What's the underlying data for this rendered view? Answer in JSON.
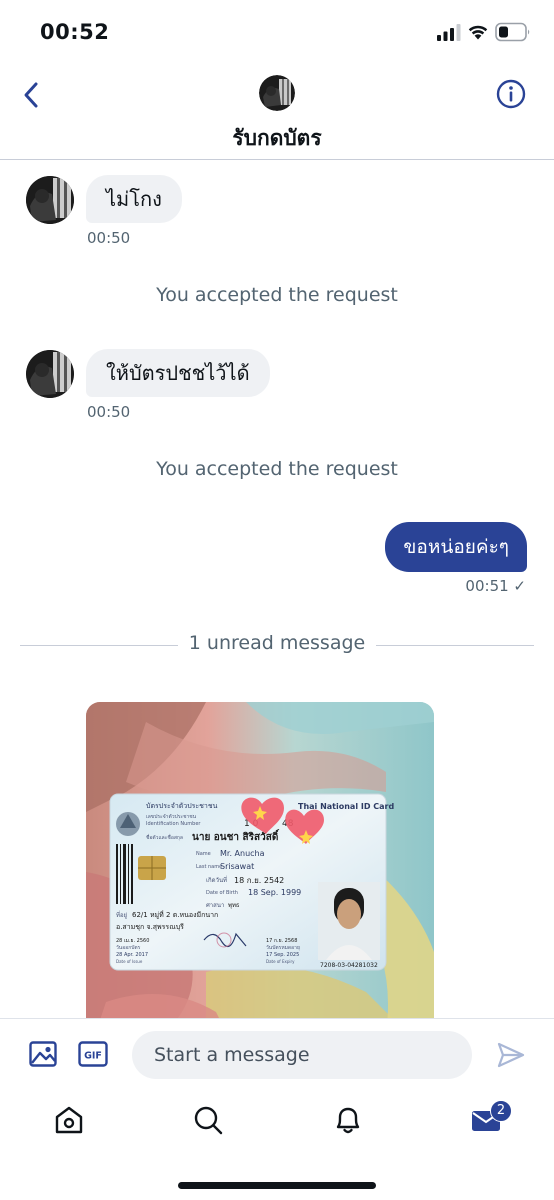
{
  "status_bar": {
    "time": "00:52"
  },
  "header": {
    "title": "รับกดบัตร"
  },
  "messages": [
    {
      "direction": "incoming",
      "text": "ไม่โกง",
      "time": "00:50"
    },
    {
      "system": "You accepted the request"
    },
    {
      "direction": "incoming",
      "text": "ให้บัตรปชชไว้ได้",
      "time": "00:50"
    },
    {
      "system": "You accepted the request"
    },
    {
      "direction": "outgoing",
      "text": "ขอหน่อยค่ะๆ",
      "time": "00:51 ✓"
    }
  ],
  "unread_divider": "1 unread message",
  "id_card": {
    "title_th": "บัตรประจำตัวประชาชน",
    "title_en": "Thai National ID Card",
    "id_label_th": "เลขประจำตัวประชาชน",
    "id_label_en": "Identification Number",
    "id_number": "1 0",
    "id_tail": "48",
    "name_label": "ชื่อตัวและชื่อสกุล",
    "name_th": "นาย อนชา สิริสวัสดิ์",
    "name_label_en": "Name",
    "name_en": "Mr. Anucha",
    "last_label_en": "Last name",
    "last_en": "Srisawat",
    "dob_label_th": "เกิดวันที่",
    "dob_th": "18 ก.ย. 2542",
    "dob_label_en": "Date of Birth",
    "dob_en": "18 Sep. 1999",
    "religion_label": "ศาสนา",
    "religion": "พุทธ",
    "address_label": "ที่อยู่",
    "address_1": "62/1 หมู่ที่ 2 ต.หนองมีกนาก",
    "address_2": "อ.สามชุก จ.สุพรรณบุรี",
    "issue_th": "28 เม.ย. 2560",
    "issue_label_th": "วันออกบัตร",
    "issue_en": "28 Apr. 2017",
    "issue_label_en": "Date of Issue",
    "expiry_th": "17 ก.ย. 2568",
    "expiry_label_th": "วันบัตรหมดอายุ",
    "expiry_en": "17 Sep. 2025",
    "expiry_label_en": "Date of Expiry",
    "serial": "7208-03-04281032"
  },
  "composer": {
    "placeholder": "Start a message",
    "gif_label": "GIF"
  },
  "tabbar": {
    "badge": "2"
  },
  "colors": {
    "accent": "#2a4396",
    "bubble_in": "#eff1f4",
    "muted_text": "#536471"
  }
}
